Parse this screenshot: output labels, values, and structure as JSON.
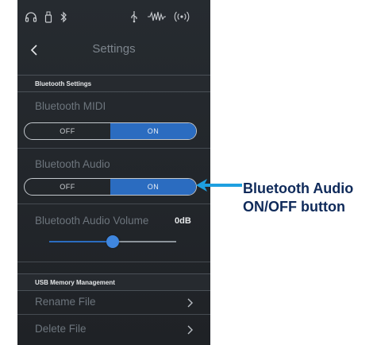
{
  "status_icons": [
    "headphones-icon",
    "usb-stick-icon",
    "bluetooth-icon",
    "usb-connection-icon",
    "audio-wave-icon",
    "wireless-icon"
  ],
  "header": {
    "title": "Settings"
  },
  "bluetooth_section": {
    "header": "Bluetooth Settings",
    "midi": {
      "label": "Bluetooth MIDI",
      "off_label": "OFF",
      "on_label": "ON",
      "selected": "ON"
    },
    "audio": {
      "label": "Bluetooth Audio",
      "off_label": "OFF",
      "on_label": "ON",
      "selected": "ON"
    },
    "volume": {
      "label": "Bluetooth Audio Volume",
      "value": "0dB",
      "level": 0.5
    }
  },
  "usb_section": {
    "header": "USB Memory Management",
    "items": [
      {
        "label": "Rename File"
      },
      {
        "label": "Delete File"
      }
    ]
  },
  "callout": {
    "line1": "Bluetooth Audio",
    "line2": "ON/OFF button"
  },
  "colors": {
    "accent": "#2b6cc0",
    "callout_arrow": "#1e9fe0",
    "callout_text": "#0f2a5a"
  }
}
